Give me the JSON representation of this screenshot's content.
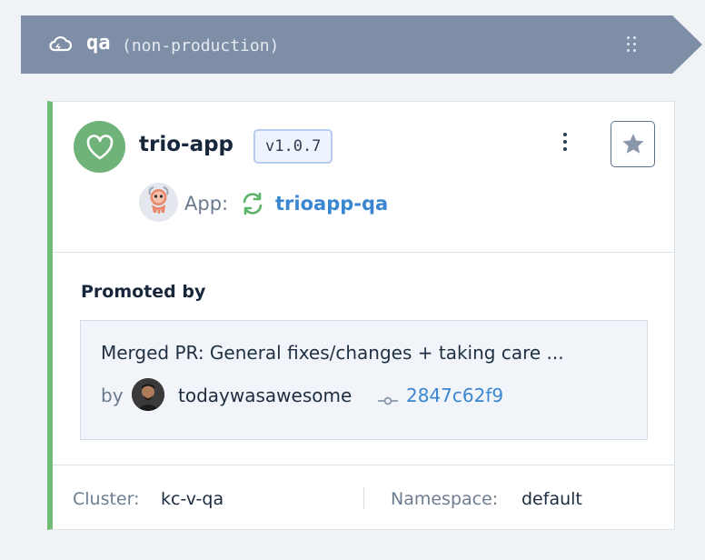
{
  "environment": {
    "name": "qa",
    "label": "(non-production)",
    "cloud_icon": "cloud-sync-icon",
    "drag_icon": "drag-handle-icon"
  },
  "app": {
    "health_icon": "heart-icon",
    "name": "trio-app",
    "version": "v1.0.7",
    "menu_icon": "kebab-menu-icon",
    "star_icon": "star-icon",
    "link_label": "App:",
    "link_text": "trioapp-qa",
    "sync_icon": "sync-icon",
    "argo_icon": "argo-icon"
  },
  "promotion": {
    "title": "Promoted by",
    "pr_title": "Merged PR: General fixes/changes + taking care ...",
    "by_label": "by",
    "username": "todaywasawesome",
    "commit_icon": "commit-icon",
    "commit_hash": "2847c62f9"
  },
  "footer": {
    "cluster_label": "Cluster:",
    "cluster_value": "kc-v-qa",
    "namespace_label": "Namespace:",
    "namespace_value": "default"
  },
  "colors": {
    "header_bg": "#7e8ea6",
    "health_green": "#70b37a",
    "accent_bar": "#71bd78",
    "link_blue": "#3a86d1"
  }
}
